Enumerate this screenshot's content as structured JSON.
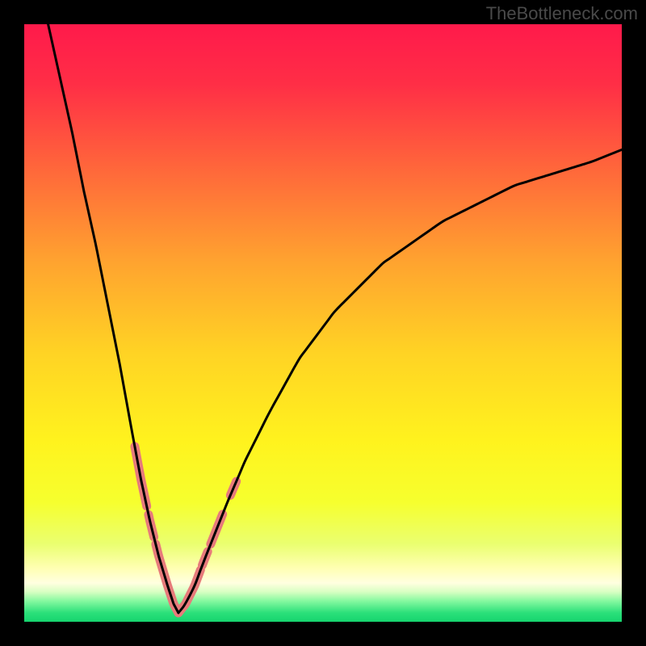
{
  "watermark": "TheBottleneck.com",
  "chart_data": {
    "type": "line",
    "title": "",
    "xlabel": "",
    "ylabel": "",
    "xlim": [
      0,
      100
    ],
    "ylim": [
      0,
      100
    ],
    "gradient_stops": [
      {
        "offset": 0.0,
        "color": "#ff1a4b"
      },
      {
        "offset": 0.1,
        "color": "#ff2e46"
      },
      {
        "offset": 0.25,
        "color": "#ff6a3a"
      },
      {
        "offset": 0.4,
        "color": "#ffa42f"
      },
      {
        "offset": 0.55,
        "color": "#ffd324"
      },
      {
        "offset": 0.7,
        "color": "#fff31e"
      },
      {
        "offset": 0.8,
        "color": "#f6ff2e"
      },
      {
        "offset": 0.87,
        "color": "#eaff70"
      },
      {
        "offset": 0.91,
        "color": "#ffffb2"
      },
      {
        "offset": 0.935,
        "color": "#ffffe0"
      },
      {
        "offset": 0.95,
        "color": "#d8ffc2"
      },
      {
        "offset": 0.965,
        "color": "#86f9a0"
      },
      {
        "offset": 0.985,
        "color": "#2be07a"
      },
      {
        "offset": 1.0,
        "color": "#16d46e"
      }
    ],
    "series": [
      {
        "name": "left-branch",
        "x": [
          4,
          6,
          8,
          10,
          12,
          14,
          16,
          18,
          19.5,
          21,
          22.5,
          24,
          25,
          25.8
        ],
        "y": [
          100,
          91,
          82,
          72,
          63,
          53,
          43,
          32,
          24,
          17,
          11,
          6,
          3,
          1.5
        ]
      },
      {
        "name": "right-branch",
        "x": [
          25.8,
          27,
          28.5,
          30,
          32,
          34,
          37,
          41,
          46,
          52,
          60,
          70,
          82,
          95,
          100
        ],
        "y": [
          1.5,
          3,
          6,
          10,
          15,
          20,
          27,
          35,
          44,
          52,
          60,
          67,
          73,
          77,
          79
        ]
      }
    ],
    "highlight_segments": {
      "color": "#e77b7b",
      "stroke_width": 11,
      "segments": [
        {
          "branch": "left-branch",
          "x_from": 18.5,
          "x_to": 20.5
        },
        {
          "branch": "left-branch",
          "x_from": 20.8,
          "x_to": 21.7
        },
        {
          "branch": "left-branch",
          "x_from": 22.0,
          "x_to": 25.3
        },
        {
          "branch": "left-branch",
          "x_from": 25.3,
          "x_to": 25.8
        },
        {
          "branch": "right-branch",
          "x_from": 25.8,
          "x_to": 29.5
        },
        {
          "branch": "right-branch",
          "x_from": 29.8,
          "x_to": 30.7
        },
        {
          "branch": "right-branch",
          "x_from": 31.2,
          "x_to": 33.2
        },
        {
          "branch": "right-branch",
          "x_from": 34.5,
          "x_to": 35.5
        }
      ]
    }
  }
}
